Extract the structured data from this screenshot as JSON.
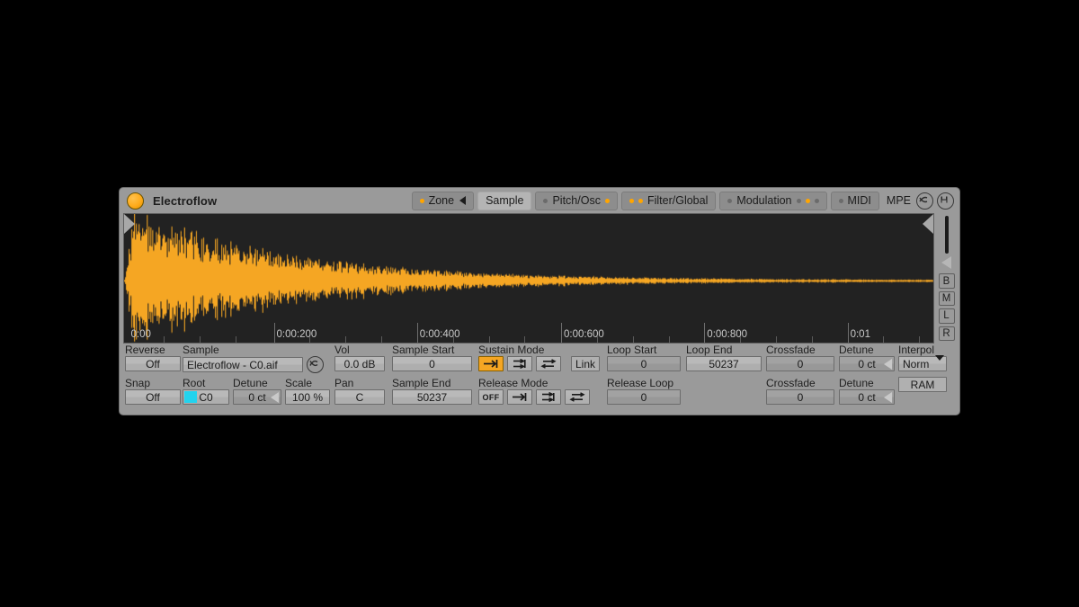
{
  "device": {
    "name": "Electroflow",
    "power_led": "on",
    "accent_color": "#ffa500"
  },
  "tabs": [
    {
      "id": "zone",
      "label": "Zone",
      "active": false,
      "dots_before": 1,
      "dots_after": 0,
      "arrow": true
    },
    {
      "id": "sample",
      "label": "Sample",
      "active": true,
      "dots_before": 0,
      "dots_after": 0,
      "arrow": false
    },
    {
      "id": "pitch-osc",
      "label": "Pitch/Osc",
      "active": false,
      "dots_before": 1,
      "dots_after": 1,
      "arrow": false
    },
    {
      "id": "filter-global",
      "label": "Filter/Global",
      "active": false,
      "dots_before": 2,
      "dots_after": 0,
      "arrow": false
    },
    {
      "id": "modulation",
      "label": "Modulation",
      "active": false,
      "dots_before": 1,
      "dots_after": 3,
      "arrow": false
    },
    {
      "id": "midi",
      "label": "MIDI",
      "active": false,
      "dots_before": 1,
      "dots_after": 0,
      "arrow": false
    }
  ],
  "titlebar": {
    "mpe_label": "MPE",
    "mpe_toggle_icon": "mpe-circle-icon",
    "save_icon": "save-disk-icon"
  },
  "waveform": {
    "background": "#222222",
    "color": "#f5a623",
    "ruler_labels": [
      "0:00",
      "0:00:200",
      "0:00:400",
      "0:00:600",
      "0:00:800",
      "0:01"
    ],
    "ruler_positions_pct": [
      0.5,
      18.5,
      36.2,
      54.0,
      71.7,
      89.4
    ],
    "sample_markers": {
      "start": "left-marker",
      "end": "right-marker"
    }
  },
  "side_buttons": [
    {
      "id": "collapse",
      "label": "",
      "icon": "triangle-left-icon"
    },
    {
      "id": "b",
      "label": "B"
    },
    {
      "id": "m",
      "label": "M"
    },
    {
      "id": "l",
      "label": "L"
    },
    {
      "id": "r",
      "label": "R"
    }
  ],
  "controls": {
    "reverse": {
      "label": "Reverse",
      "value": "Off"
    },
    "snap": {
      "label": "Snap",
      "value": "Off"
    },
    "sample": {
      "label": "Sample",
      "value": "Electroflow - C0.aif",
      "reload_icon": "refresh-icon"
    },
    "root": {
      "label": "Root",
      "value": "C0",
      "swatch": "#22d3ee"
    },
    "root_detune": {
      "label": "Detune",
      "value": "0 ct"
    },
    "scale": {
      "label": "Scale",
      "value": "100 %"
    },
    "vol": {
      "label": "Vol",
      "value": "0.0 dB"
    },
    "pan": {
      "label": "Pan",
      "value": "C"
    },
    "sample_start": {
      "label": "Sample Start",
      "value": "0"
    },
    "sample_end": {
      "label": "Sample End",
      "value": "50237"
    },
    "sustain_mode": {
      "label": "Sustain Mode",
      "options": [
        "no-loop",
        "loop-forward",
        "loop-pingpong"
      ],
      "selected": 0
    },
    "link": {
      "label": "Link"
    },
    "release_mode": {
      "label": "Release Mode",
      "options": [
        "OFF",
        "no-loop",
        "loop-forward",
        "loop-pingpong"
      ],
      "selected": 0
    },
    "loop_start": {
      "label": "Loop Start",
      "value": "0"
    },
    "loop_end": {
      "label": "Loop End",
      "value": "50237"
    },
    "release_loop": {
      "label": "Release Loop",
      "value": "0"
    },
    "loop_crossfade": {
      "label": "Crossfade",
      "value": "0"
    },
    "loop_detune": {
      "label": "Detune",
      "value": "0 ct"
    },
    "rel_crossfade": {
      "label": "Crossfade",
      "value": "0"
    },
    "rel_detune": {
      "label": "Detune",
      "value": "0 ct"
    },
    "interpol": {
      "label": "Interpol",
      "value": "Norm"
    },
    "ram": {
      "label": "RAM"
    }
  }
}
